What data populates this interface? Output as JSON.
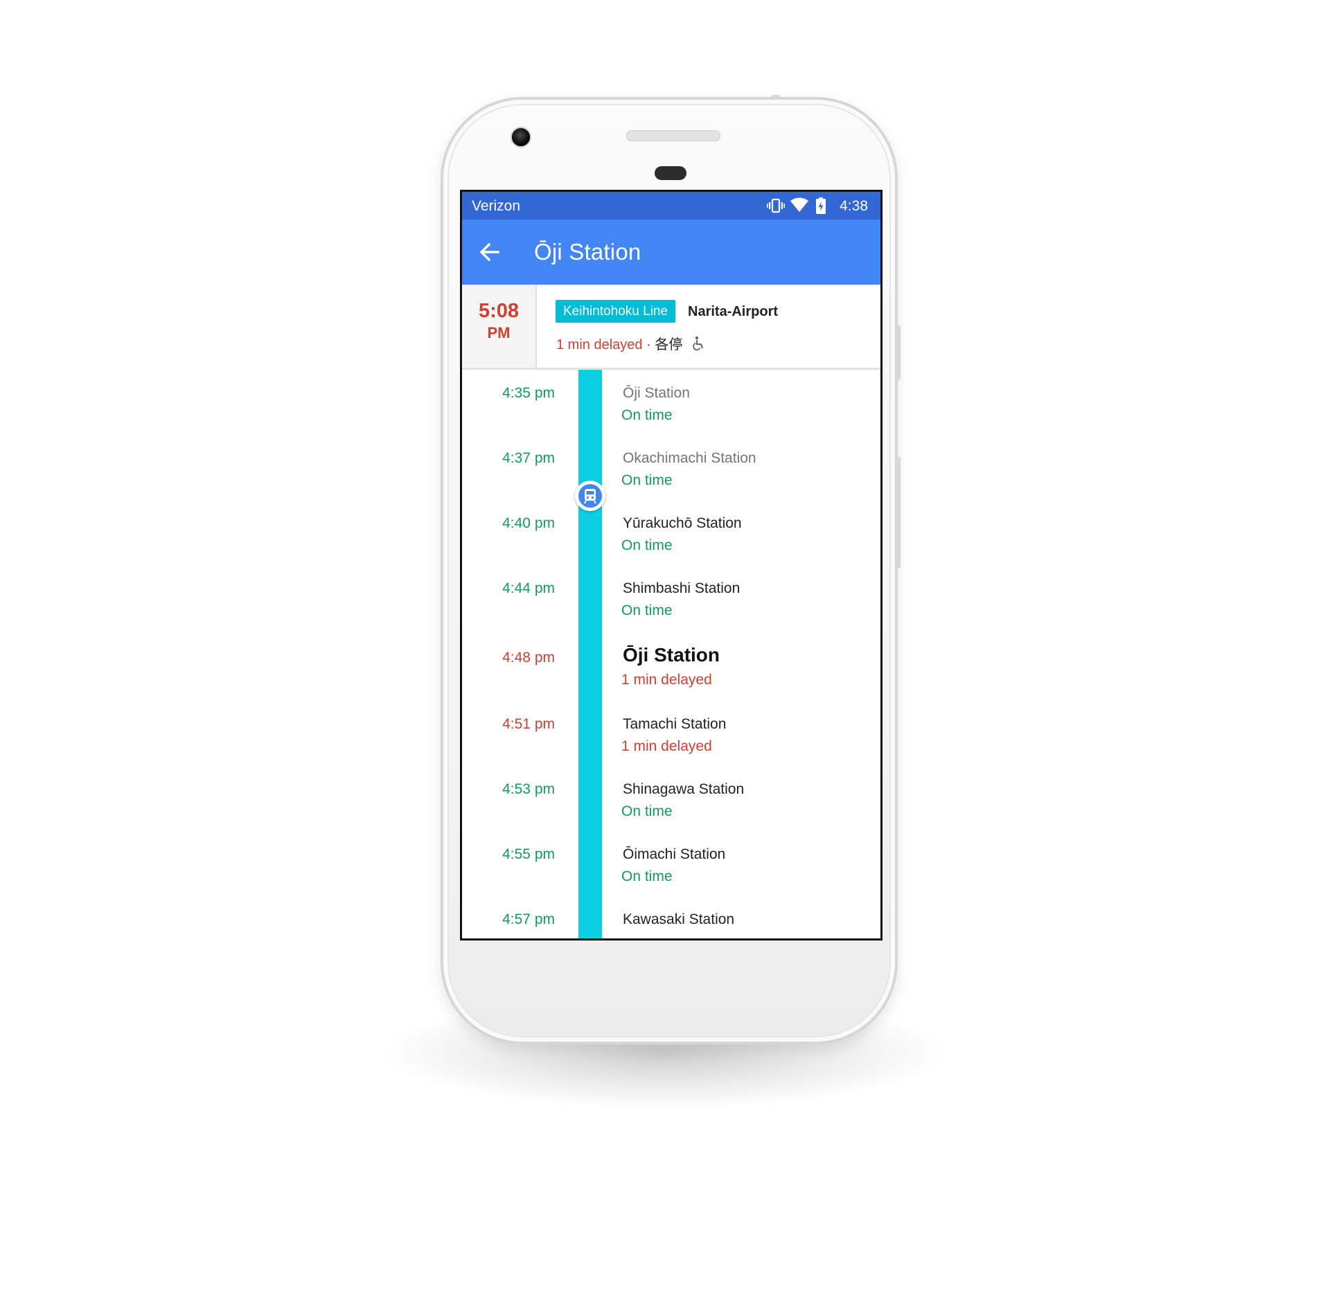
{
  "colors": {
    "status_bar": "#3367d6",
    "app_bar": "#4285f4",
    "line_color": "#0dcfe3",
    "on_time": "#0f9d58",
    "delayed": "#d23f31"
  },
  "status_bar": {
    "carrier": "Verizon",
    "time": "4:38",
    "icons": [
      "vibrate-icon",
      "wifi-icon",
      "battery-charging-icon"
    ]
  },
  "app_bar": {
    "back_icon": "arrow-back-icon",
    "title": "Ōji Station"
  },
  "departure": {
    "time": "5:08",
    "ampm": "PM",
    "line": "Keihintohoku Line",
    "destination": "Narita-Airport",
    "delay": "1 min delayed",
    "separator": "·",
    "service_type": "各停",
    "accessibility_icon": "wheelchair-icon"
  },
  "stops": [
    {
      "time": "4:35 pm",
      "name": "Ōji Station",
      "status": "On time"
    },
    {
      "time": "4:37 pm",
      "name": "Okachimachi Station",
      "status": "On time"
    },
    {
      "time": "4:40 pm",
      "name": "Yūrakuchō Station",
      "status": "On time"
    },
    {
      "time": "4:44 pm",
      "name": "Shimbashi Station",
      "status": "On time"
    },
    {
      "time": "4:48 pm",
      "name": "Ōji Station",
      "status": "1 min delayed"
    },
    {
      "time": "4:51 pm",
      "name": "Tamachi Station",
      "status": "1 min delayed"
    },
    {
      "time": "4:53 pm",
      "name": "Shinagawa Station",
      "status": "On time"
    },
    {
      "time": "4:55 pm",
      "name": "Ōimachi Station",
      "status": "On time"
    },
    {
      "time": "4:57 pm",
      "name": "Kawasaki Station",
      "status": ""
    }
  ]
}
